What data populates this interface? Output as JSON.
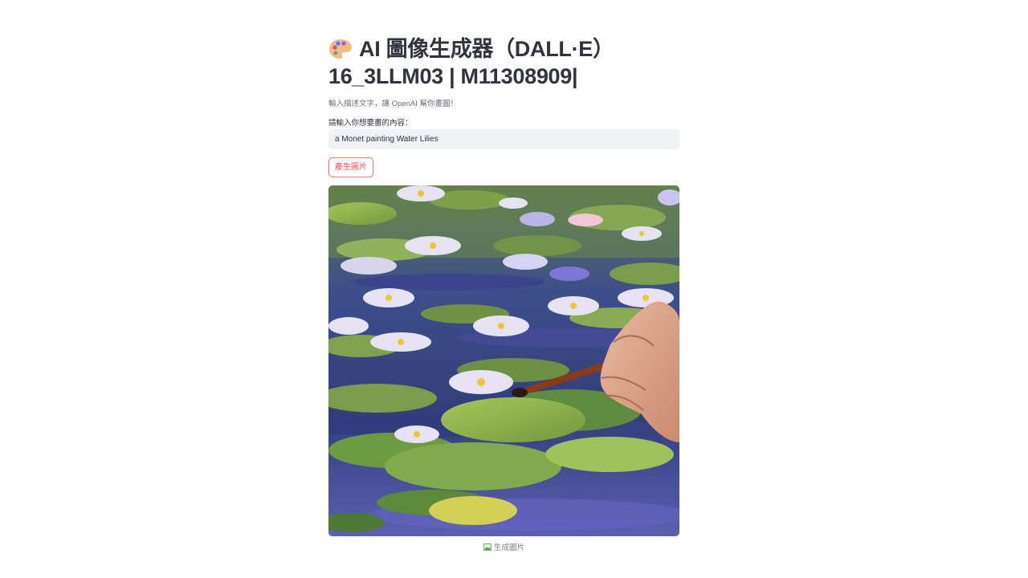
{
  "page": {
    "title_line1": "AI 圖像生成器（DALL·E）",
    "title_line2": "16_3LLM03 | M11308909|",
    "title_icon": "artist-palette-icon",
    "description": "輸入描述文字，讓 OpenAI 幫你畫圖！"
  },
  "form": {
    "prompt_label": "請輸入你想要畫的內容：",
    "prompt_value": "a Monet painting Water Lilies",
    "generate_label": "產生圖片"
  },
  "result": {
    "image_subject": "Monet-style water lilies painting with a hand holding a brush",
    "caption": "生成圖片",
    "caption_icon": "image-icon"
  },
  "colors": {
    "accent": "#ff4b4b",
    "input_bg": "#f0f2f6",
    "text": "#31333f"
  }
}
